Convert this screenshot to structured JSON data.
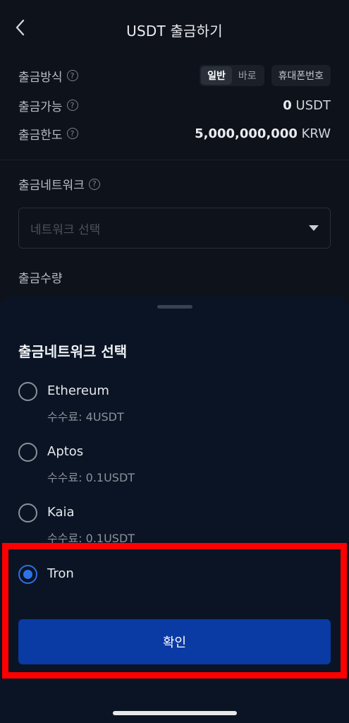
{
  "header": {
    "title": "USDT 출금하기",
    "back_icon": "chevron-left-icon"
  },
  "info": {
    "method_label": "출금방식",
    "method_options": [
      "일반",
      "바로"
    ],
    "method_selected": "일반",
    "phone_option": "휴대폰번호",
    "available_label": "출금가능",
    "available_amount": "0",
    "available_unit": "USDT",
    "limit_label": "출금한도",
    "limit_amount": "5,000,000,000",
    "limit_unit": "KRW",
    "help_glyph": "?"
  },
  "network": {
    "label": "출금네트워크",
    "placeholder": "네트워크 선택"
  },
  "quantity": {
    "label": "출금수량"
  },
  "sheet": {
    "title": "출금네트워크 선택",
    "options": [
      {
        "name": "Ethereum",
        "fee": "수수료: 4USDT",
        "selected": false
      },
      {
        "name": "Aptos",
        "fee": "수수료: 0.1USDT",
        "selected": false
      },
      {
        "name": "Kaia",
        "fee": "수수료: 0.1USDT",
        "selected": false
      },
      {
        "name": "Tron",
        "fee": "",
        "selected": true
      }
    ],
    "confirm_label": "확인"
  },
  "colors": {
    "accent": "#2f72e6",
    "confirm_bg": "#0a3aa3",
    "highlight": "#ff0000"
  }
}
